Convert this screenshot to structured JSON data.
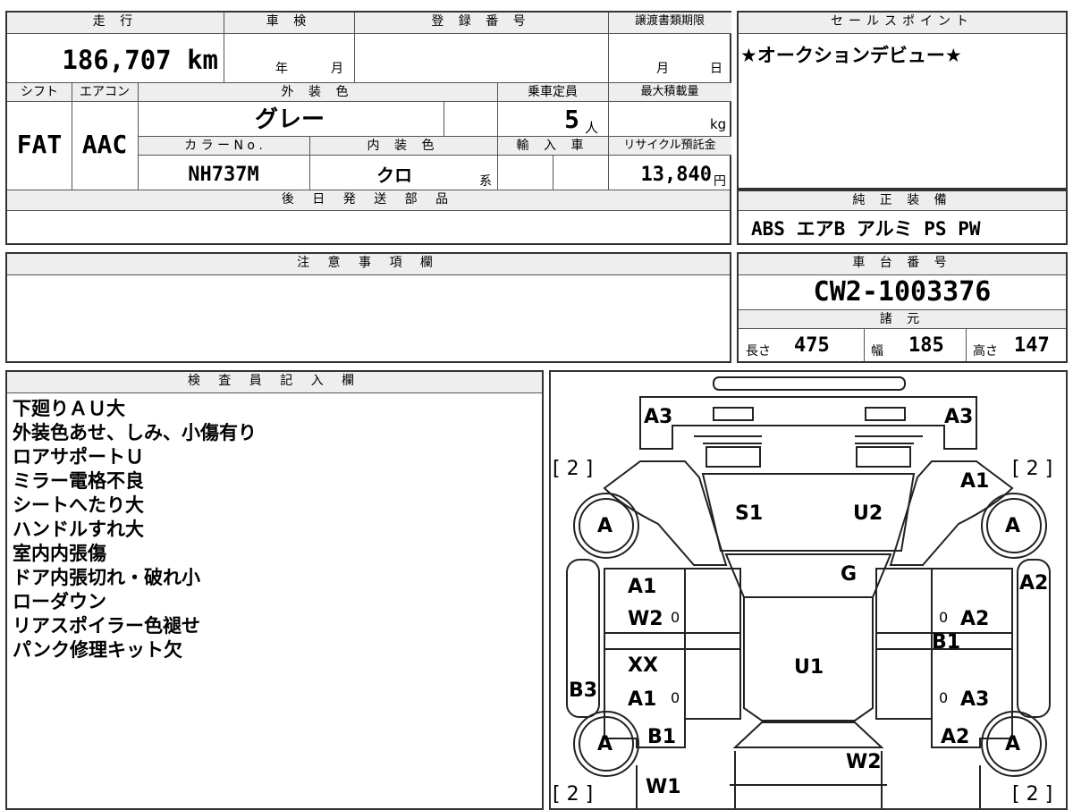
{
  "top_table": {
    "headers": {
      "mileage": "走 行",
      "inspection": "車 検",
      "registration": "登 録 番 号",
      "transfer_deadline": "譲渡書類期限",
      "shift": "シフト",
      "aircon": "エアコン",
      "exterior_color": "外 装 色",
      "capacity": "乗車定員",
      "max_load": "最大積載量",
      "color_no": "カ ラ ー N o .",
      "interior_color": "内 装 色",
      "import": "輸 入 車",
      "recycle_fee": "リサイクル預託金",
      "later_parts": "後 日 発 送 部 品"
    },
    "values": {
      "mileage": "186,707 km",
      "inspection_year_unit": "年",
      "inspection_month_unit": "月",
      "deadline_month_unit": "月",
      "deadline_day_unit": "日",
      "shift": "FAT",
      "aircon": "AAC",
      "exterior_color": "グレー",
      "capacity": "5",
      "capacity_unit": "人",
      "max_load_unit": "kg",
      "color_no": "NH737M",
      "interior_color": "クロ",
      "interior_suffix": "系",
      "recycle_fee": "13,840",
      "recycle_unit": "円"
    }
  },
  "sales_point": {
    "header": "セールスポイント",
    "text": "★オークションデビュー★"
  },
  "genuine_equipment": {
    "header": "純 正 装 備",
    "items": "ABS エアB アルミ PS PW"
  },
  "notes": {
    "header": "注 意 事 項 欄"
  },
  "chassis": {
    "header": "車 台 番 号",
    "number": "CW2-1003376"
  },
  "specs": {
    "header": "諸 元",
    "length_label": "長さ",
    "length": "475",
    "width_label": "幅",
    "width": "185",
    "height_label": "高さ",
    "height": "147"
  },
  "inspector": {
    "header": "検 査 員 記 入 欄",
    "lines": [
      "下廻りＡＵ大",
      "外装色あせ、しみ、小傷有り",
      "ロアサポートＵ",
      "ミラー電格不良",
      "シートへたり大",
      "ハンドルすれ大",
      "室内内張傷",
      "ドア内張切れ・破れ小",
      "ローダウン",
      "リアスポイラー色褪せ",
      "パンク修理キット欠"
    ]
  },
  "diagram": {
    "labels": {
      "front_left_bumper": "A3",
      "front_right_bumper": "A3",
      "left_tire_count": "[ 2 ]",
      "right_tire_count": "[ 2 ]",
      "right_fender": "A1",
      "hood_left": "S1",
      "hood_right": "U2",
      "front_left_tire": "A",
      "front_right_tire": "A",
      "windshield": "G",
      "right_pillar": "A2",
      "left_front_door_1": "A1",
      "left_front_door_2": "W2",
      "left_front_door_mark": "0",
      "right_front_door_mark": "0",
      "right_front_door": "A2",
      "right_sill": "B1",
      "roof": "U1",
      "left_rear_door_1": "XX",
      "left_rear_door_2": "A1",
      "left_rear_door_mark": "0",
      "right_rear_door_mark": "0",
      "right_rear_door": "A3",
      "left_sill": "B3",
      "rear_left_tire": "A",
      "rear_right_tire": "A",
      "left_quarter": "B1",
      "right_quarter": "A2",
      "trunk": "W2",
      "left_rear_quarter": "W1",
      "bottom_left_tire_count": "[ 2 ]",
      "bottom_right_tire_count": "[ 2 ]"
    }
  }
}
